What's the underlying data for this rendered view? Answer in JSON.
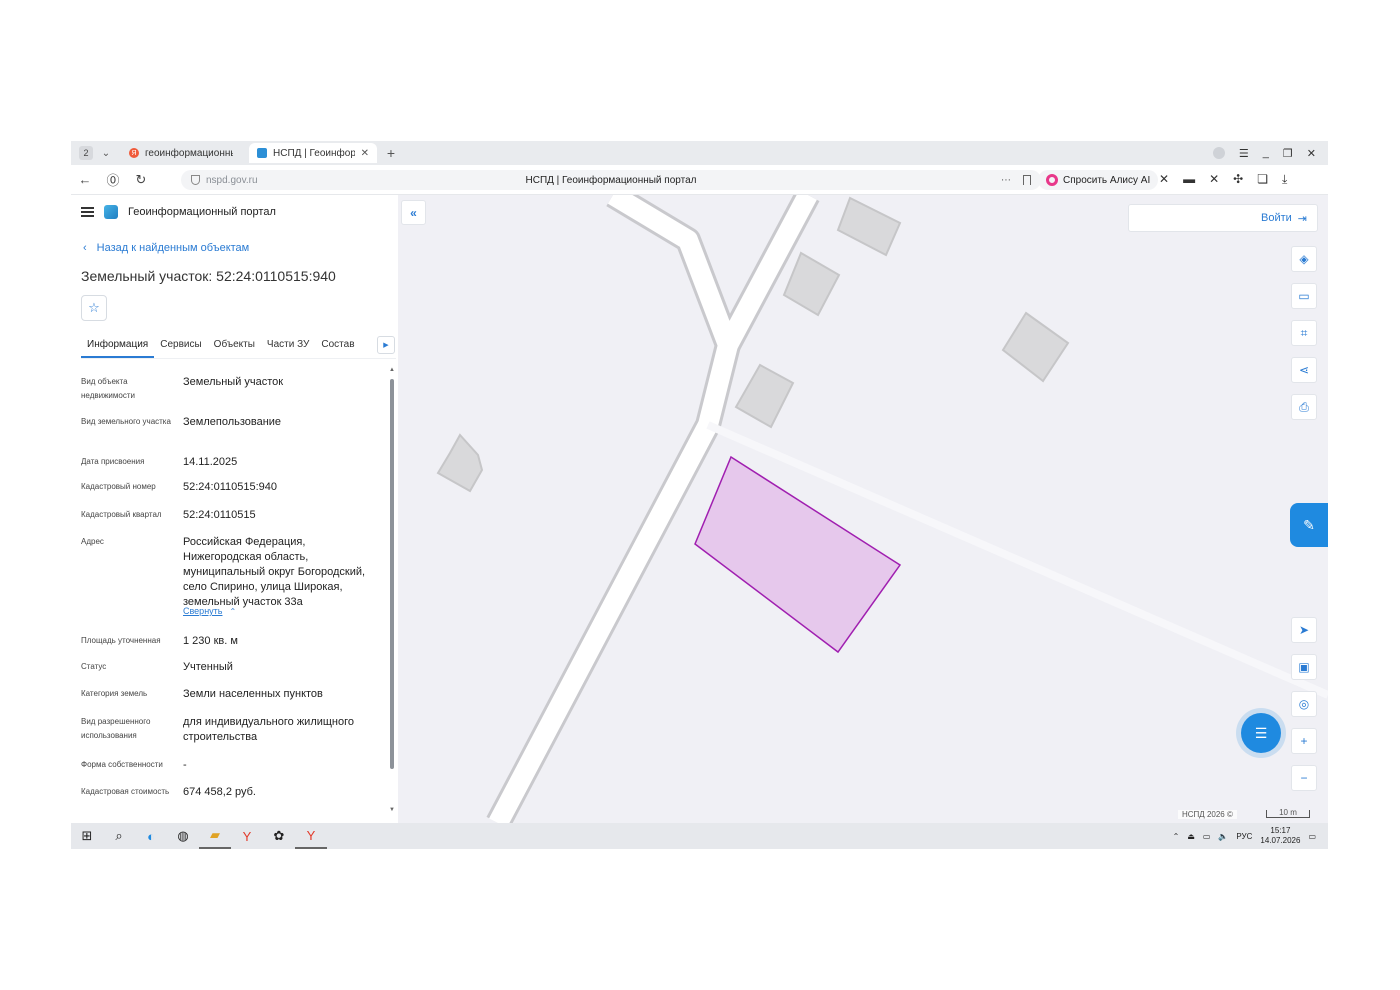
{
  "browser": {
    "tab_count": "2",
    "tabs": [
      {
        "label": "геоинформационный пор",
        "active": false
      },
      {
        "label": "НСПД | Геоинформаци",
        "active": true
      }
    ],
    "url": "nspd.gov.ru",
    "page_title": "НСПД | Геоинформационный портал",
    "alice_label": "Спросить Алису AI"
  },
  "app": {
    "title": "Геоинформационный портал",
    "back_label": "Назад к найденным объектам",
    "object_title": "Земельный участок: 52:24:0110515:940",
    "tabs": [
      "Информация",
      "Сервисы",
      "Объекты",
      "Части ЗУ",
      "Состав"
    ],
    "properties": [
      {
        "key": "Вид объекта недвижимости",
        "value": "Земельный участок"
      },
      {
        "key": "Вид земельного участка",
        "value": "Землепользование"
      },
      {
        "key": "Дата присвоения",
        "value": "14.11.2025"
      },
      {
        "key": "Кадастровый номер",
        "value": "52:24:0110515:940"
      },
      {
        "key": "Кадастровый квартал",
        "value": "52:24:0110515"
      },
      {
        "key": "Адрес",
        "value": "Российская Федерация, Нижегородская область, муниципальный округ Богородский, село Спирино, улица Широкая, земельный участок 33а"
      },
      {
        "key": "Площадь уточненная",
        "value": "1 230 кв. м"
      },
      {
        "key": "Статус",
        "value": "Учтенный"
      },
      {
        "key": "Категория земель",
        "value": "Земли населенных пунктов"
      },
      {
        "key": "Вид разрешенного использования",
        "value": "для индивидуального жилищного строительства"
      },
      {
        "key": "Форма собственности",
        "value": "-"
      },
      {
        "key": "Кадастровая стоимость",
        "value": "674 458,2 руб."
      }
    ],
    "collapse_label": "Свернуть"
  },
  "map": {
    "login_label": "Войти",
    "attribution": "НСПД 2026 ©",
    "scale_label": "10 m",
    "parcel_fill": "#e6c8ec",
    "parcel_stroke": "#a01fb0"
  },
  "taskbar": {
    "lang": "РУС",
    "time": "15:17",
    "date": "14.07.2026"
  }
}
